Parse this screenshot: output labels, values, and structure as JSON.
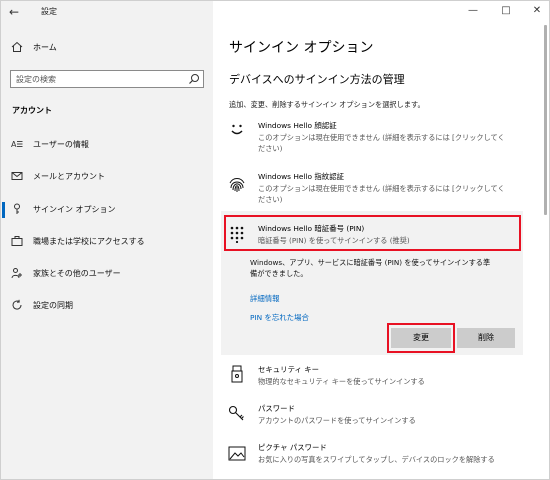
{
  "window": {
    "app_title": "設定",
    "back": "←",
    "controls": {
      "minimize": "—",
      "maximize": "□",
      "close": "✕"
    }
  },
  "sidebar": {
    "home": "ホーム",
    "search_placeholder": "設定の検索",
    "section": "アカウント",
    "items": [
      {
        "label": "ユーザーの情報",
        "icon": "person-card-icon"
      },
      {
        "label": "メールとアカウント",
        "icon": "mail-icon"
      },
      {
        "label": "サインイン オプション",
        "icon": "key-icon",
        "active": true
      },
      {
        "label": "職場または学校にアクセスする",
        "icon": "briefcase-icon"
      },
      {
        "label": "家族とその他のユーザー",
        "icon": "people-icon"
      },
      {
        "label": "設定の同期",
        "icon": "sync-icon"
      }
    ]
  },
  "main": {
    "title": "サインイン オプション",
    "subhead": "デバイスへのサインイン方法の管理",
    "intro": "追加、変更、削除するサインイン オプションを選択します。",
    "options": [
      {
        "title": "Windows Hello 顔認証",
        "desc": "このオプションは現在使用できません (詳細を表示するには [クリックしてく\nださい)",
        "icon": "face-icon"
      },
      {
        "title": "Windows Hello 指紋認証",
        "desc": "このオプションは現在使用できません (詳細を表示するには [クリックしてく\nださい)",
        "icon": "fingerprint-icon"
      },
      {
        "title": "Windows Hello 暗証番号 (PIN)",
        "desc": "暗証番号 (PIN) を使ってサインインする (推奨)",
        "icon": "pin-keypad-icon"
      }
    ],
    "pin": {
      "detail": "Windows、アプリ、サービスに暗証番号 (PIN) を使ってサインインする準\n備ができました。",
      "link_more": "詳細情報",
      "link_forgot": "PIN を忘れた場合",
      "change": "変更",
      "remove": "削除"
    },
    "more_options": [
      {
        "title": "セキュリティ キー",
        "desc": "物理的なセキュリティ キーを使ってサインインする",
        "icon": "usb-key-icon"
      },
      {
        "title": "パスワード",
        "desc": "アカウントのパスワードを使ってサインインする",
        "icon": "password-key-icon"
      },
      {
        "title": "ピクチャ パスワード",
        "desc": "お気に入りの写真をスワイプしてタップし、デバイスのロックを解除する",
        "icon": "picture-icon"
      }
    ]
  },
  "colors": {
    "accent": "#0067c0",
    "highlight": "#e81123",
    "sidebar_bg": "#f2f2f2"
  }
}
